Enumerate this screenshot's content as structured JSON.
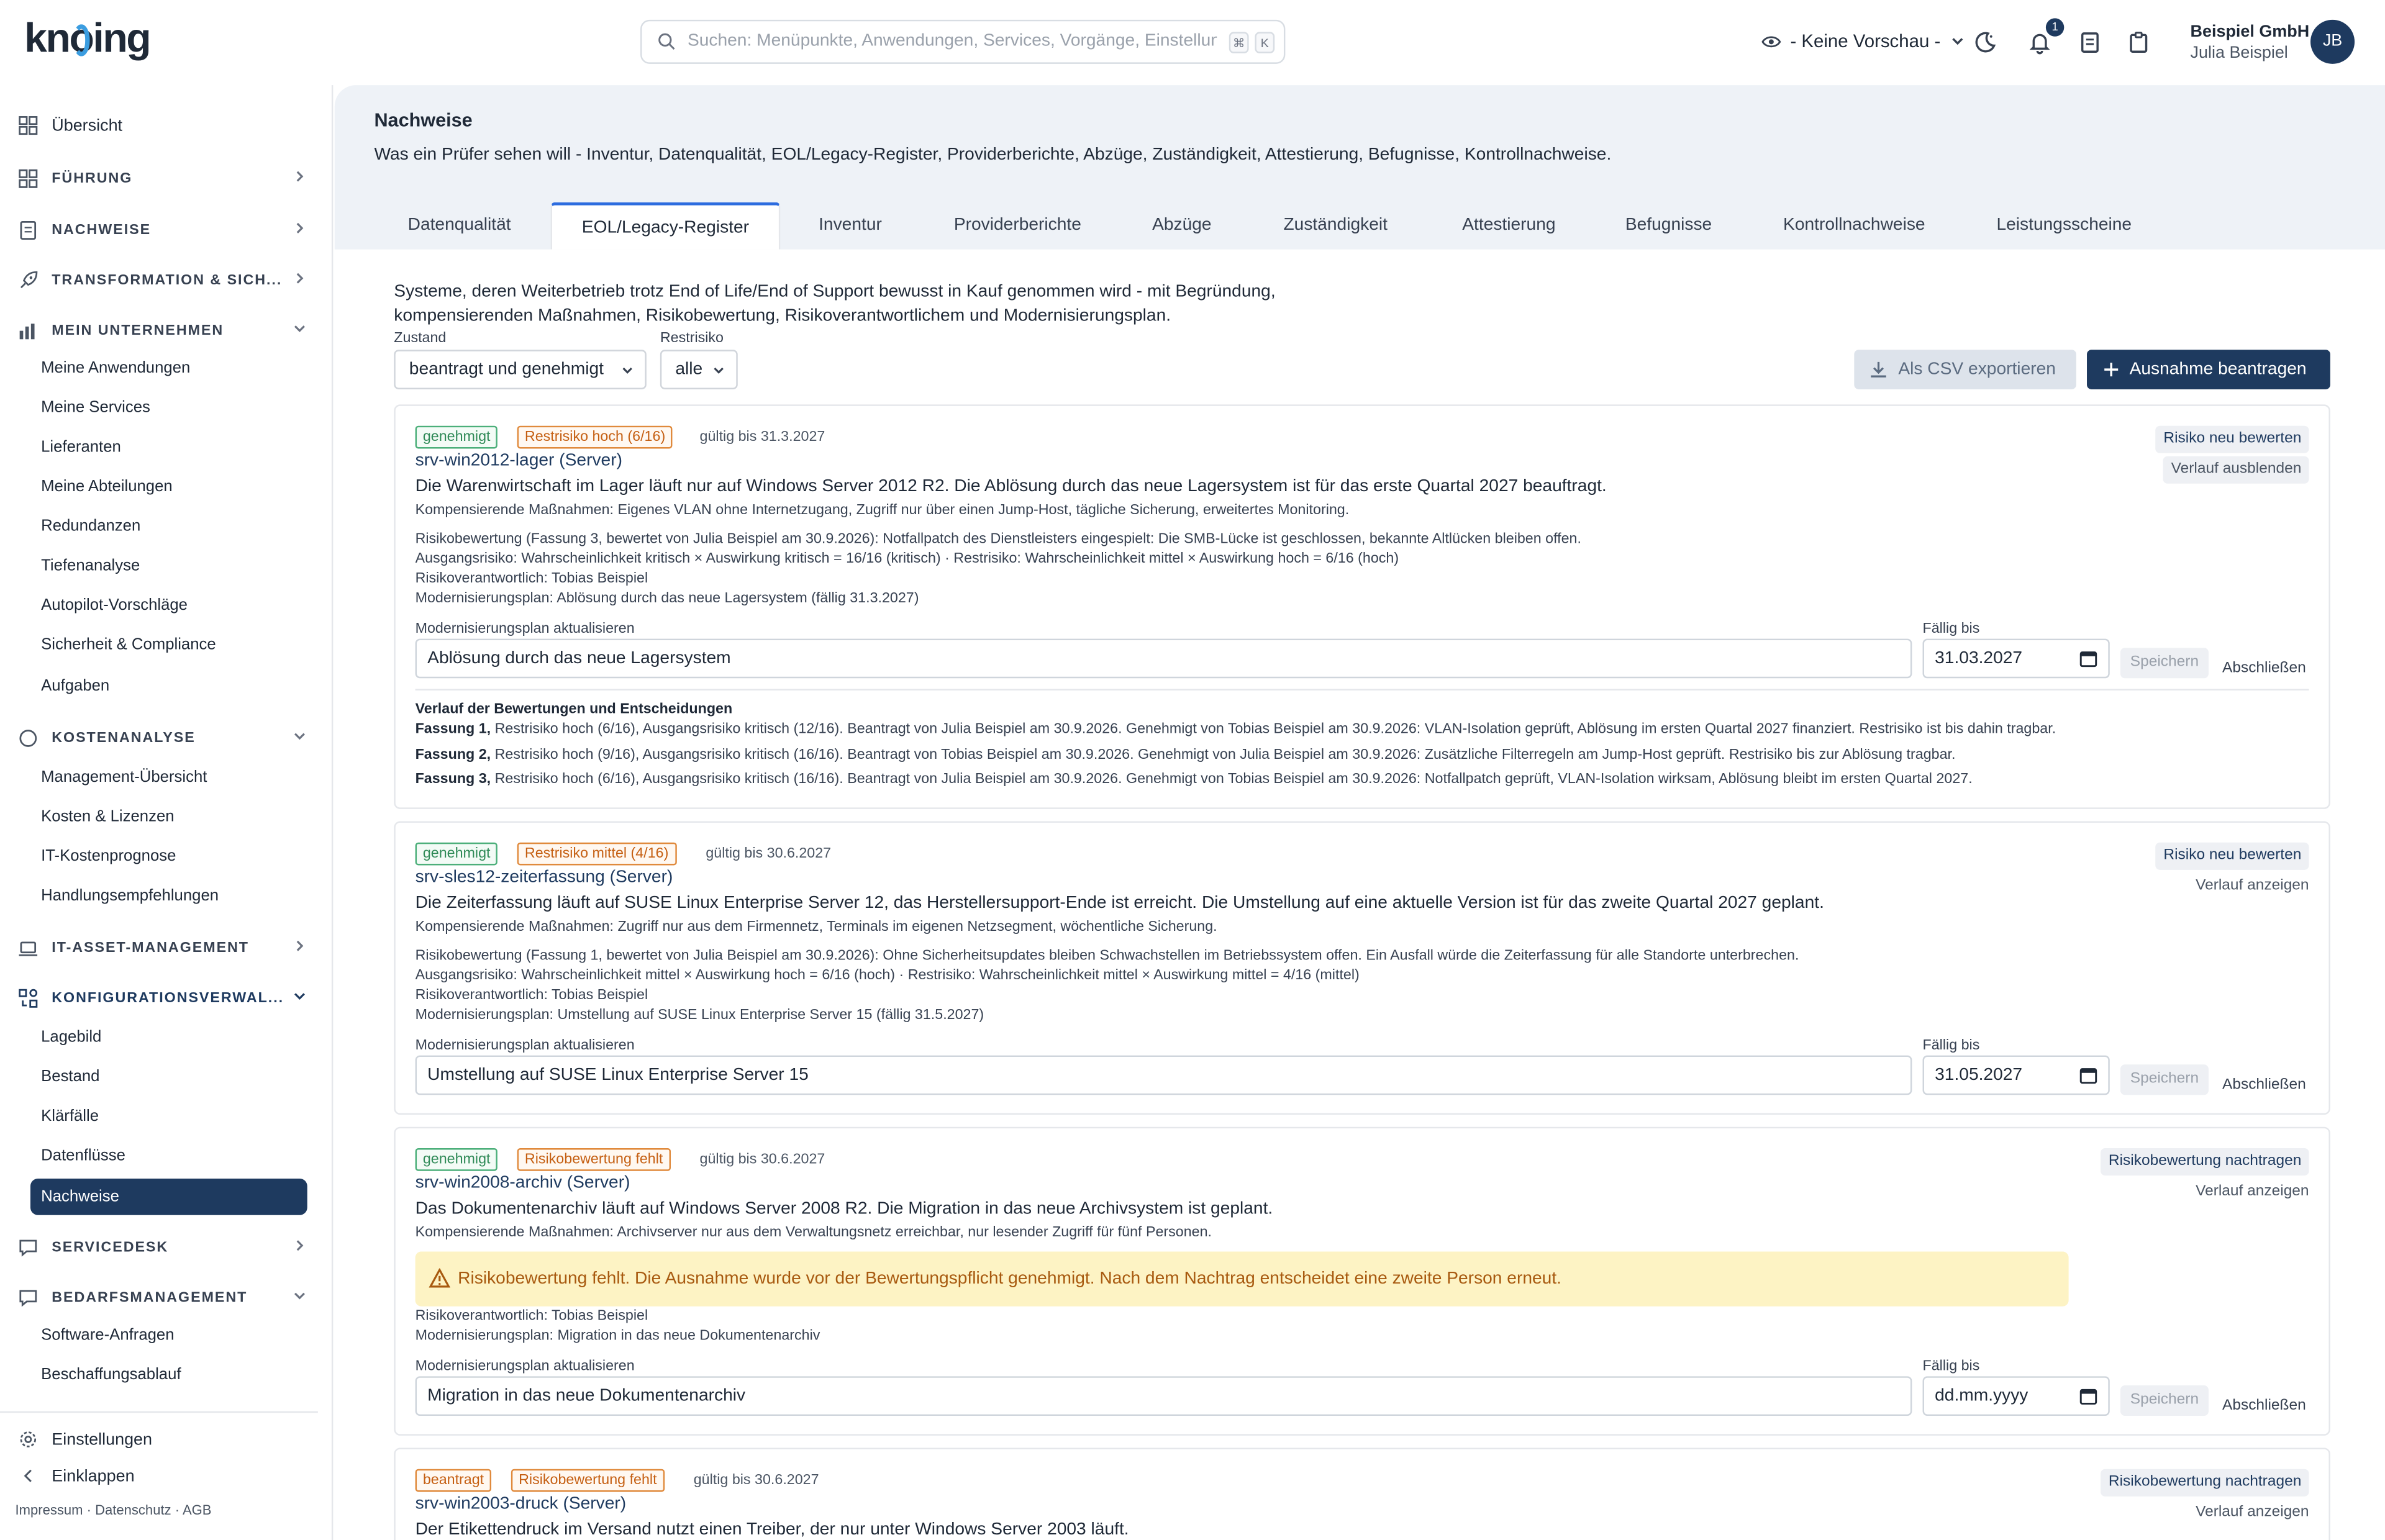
{
  "app": {
    "logo": "knoing",
    "search_placeholder": "Suchen: Menüpunkte, Anwendungen, Services, Vorgänge, Einstellungen",
    "kbd1": "⌘",
    "kbd2": "K",
    "preview": "- Keine Vorschau -",
    "notifications": "1",
    "company": "Beispiel GmbH",
    "user": "Julia Beispiel",
    "initials": "JB"
  },
  "sidebar": {
    "overview": "Übersicht",
    "fuehrung": "FÜHRUNG",
    "nachweise": "NACHWEISE",
    "transformation": "TRANSFORMATION & SICH...",
    "mein_unternehmen": "MEIN UNTERNEHMEN",
    "mu_items": [
      "Meine Anwendungen",
      "Meine Services",
      "Lieferanten",
      "Meine Abteilungen",
      "Redundanzen",
      "Tiefenanalyse",
      "Autopilot-Vorschläge",
      "Sicherheit & Compliance",
      "Aufgaben"
    ],
    "kostenanalyse": "KOSTENANALYSE",
    "ka_items": [
      "Management-Übersicht",
      "Kosten & Lizenzen",
      "IT-Kostenprognose",
      "Handlungsempfehlungen"
    ],
    "itam": "IT-ASSET-MANAGEMENT",
    "konfig": "KONFIGURATIONSVERWAL...",
    "kv_items": [
      "Lagebild",
      "Bestand",
      "Klärfälle",
      "Datenflüsse"
    ],
    "kv_active": "Nachweise",
    "servicedesk": "SERVICEDESK",
    "bedarf": "BEDARFSMANAGEMENT",
    "bm_items": [
      "Software-Anfragen",
      "Beschaffungsablauf"
    ],
    "settings": "Einstellungen",
    "collapse": "Einklappen",
    "footer": "Impressum  ·  Datenschutz  ·  AGB"
  },
  "page": {
    "title": "Nachweise",
    "subtitle": "Was ein Prüfer sehen will - Inventur, Datenqualität, EOL/Legacy-Register, Providerberichte, Abzüge, Zuständigkeit, Attestierung, Befugnisse, Kontrollnachweise.",
    "tabs": [
      "Datenqualität",
      "EOL/Legacy-Register",
      "Inventur",
      "Providerberichte",
      "Abzüge",
      "Zuständigkeit",
      "Attestierung",
      "Befugnisse",
      "Kontrollnachweise",
      "Leistungsscheine"
    ],
    "intro_1": "Systeme, deren Weiterbetrieb trotz End of Life/End of Support bewusst in Kauf genommen wird - mit Begründung,",
    "intro_2": "kompensierenden Maßnahmen, Risikobewertung, Risikoverantwortlichem und Modernisierungsplan.",
    "zustand_label": "Zustand",
    "zustand_value": "beantragt und genehmigt",
    "restrisiko_label": "Restrisiko",
    "restrisiko_value": "alle",
    "export": "Als CSV exportieren",
    "request": "Ausnahme beantragen"
  },
  "common": {
    "plan_label": "Modernisierungsplan aktualisieren",
    "due_label": "Fällig bis",
    "save": "Speichern",
    "close": "Abschließen",
    "risk_reassess": "Risiko neu bewerten",
    "risk_add": "Risikobewertung nachtragen",
    "hide_history": "Verlauf ausblenden",
    "show_history": "Verlauf anzeigen"
  },
  "cards": [
    {
      "status": "genehmigt",
      "risk": "Restrisiko hoch (6/16)",
      "valid": "gültig bis 31.3.2027",
      "name": "srv-win2012-lager (Server)",
      "desc": "Die Warenwirtschaft im Lager läuft nur auf Windows Server 2012 R2. Die Ablösung durch das neue Lagersystem ist für das erste Quartal 2027 beauftragt.",
      "comp": "Kompensierende Maßnahmen: Eigenes VLAN ohne Internetzugang, Zugriff nur über einen Jump-Host, tägliche Sicherung, erweitertes Monitoring.",
      "assessment": "Risikobewertung (Fassung 3, bewertet von Julia Beispiel am 30.9.2026): Notfallpatch des Dienstleisters eingespielt: Die SMB-Lücke ist geschlossen, bekannte Altlücken bleiben offen.",
      "baseline": "Ausgangsrisiko: Wahrscheinlichkeit kritisch × Auswirkung kritisch = 16/16 (kritisch) · Restrisiko: Wahrscheinlichkeit mittel × Auswirkung hoch = 6/16 (hoch)",
      "owner": "Risikoverantwortlich: Tobias Beispiel",
      "plan": "Modernisierungsplan: Ablösung durch das neue Lagersystem (fällig 31.3.2027)",
      "plan_value": "Ablösung durch das neue Lagersystem",
      "due_value": "31.03.2027",
      "history_title": "Verlauf der Bewertungen und Entscheidungen",
      "history": [
        {
          "v": "Fassung 1,",
          "t": " Restrisiko hoch (6/16), Ausgangsrisiko kritisch (12/16). Beantragt von Julia Beispiel am 30.9.2026. Genehmigt von Tobias Beispiel am 30.9.2026: VLAN-Isolation geprüft, Ablösung im ersten Quartal 2027 finanziert. Restrisiko ist bis dahin tragbar."
        },
        {
          "v": "Fassung 2,",
          "t": " Restrisiko hoch (9/16), Ausgangsrisiko kritisch (16/16). Beantragt von Tobias Beispiel am 30.9.2026. Genehmigt von Julia Beispiel am 30.9.2026: Zusätzliche Filterregeln am Jump-Host geprüft. Restrisiko bis zur Ablösung tragbar."
        },
        {
          "v": "Fassung 3,",
          "t": " Restrisiko hoch (6/16), Ausgangsrisiko kritisch (16/16). Beantragt von Julia Beispiel am 30.9.2026. Genehmigt von Tobias Beispiel am 30.9.2026: Notfallpatch geprüft, VLAN-Isolation wirksam, Ablösung bleibt im ersten Quartal 2027."
        }
      ]
    },
    {
      "status": "genehmigt",
      "risk": "Restrisiko mittel (4/16)",
      "valid": "gültig bis 30.6.2027",
      "name": "srv-sles12-zeiterfassung (Server)",
      "desc": "Die Zeiterfassung läuft auf SUSE Linux Enterprise Server 12, das Herstellersupport-Ende ist erreicht. Die Umstellung auf eine aktuelle Version ist für das zweite Quartal 2027 geplant.",
      "comp": "Kompensierende Maßnahmen: Zugriff nur aus dem Firmennetz, Terminals im eigenen Netzsegment, wöchentliche Sicherung.",
      "assessment": "Risikobewertung (Fassung 1, bewertet von Julia Beispiel am 30.9.2026): Ohne Sicherheitsupdates bleiben Schwachstellen im Betriebssystem offen. Ein Ausfall würde die Zeiterfassung für alle Standorte unterbrechen.",
      "baseline": "Ausgangsrisiko: Wahrscheinlichkeit mittel × Auswirkung hoch = 6/16 (hoch) · Restrisiko: Wahrscheinlichkeit mittel × Auswirkung mittel = 4/16 (mittel)",
      "owner": "Risikoverantwortlich: Tobias Beispiel",
      "plan": "Modernisierungsplan: Umstellung auf SUSE Linux Enterprise Server 15 (fällig 31.5.2027)",
      "plan_value": "Umstellung auf SUSE Linux Enterprise Server 15",
      "due_value": "31.05.2027"
    },
    {
      "status": "genehmigt",
      "risk": "Risikobewertung fehlt",
      "valid": "gültig bis 30.6.2027",
      "name": "srv-win2008-archiv (Server)",
      "desc": "Das Dokumentenarchiv läuft auf Windows Server 2008 R2. Die Migration in das neue Archivsystem ist geplant.",
      "comp": "Kompensierende Maßnahmen: Archivserver nur aus dem Verwaltungsnetz erreichbar, nur lesender Zugriff für fünf Personen.",
      "warning": "Risikobewertung fehlt. Die Ausnahme wurde vor der Bewertungspflicht genehmigt. Nach dem Nachtrag entscheidet eine zweite Person erneut.",
      "owner": "Risikoverantwortlich: Tobias Beispiel",
      "plan": "Modernisierungsplan: Migration in das neue Dokumentenarchiv",
      "plan_value": "Migration in das neue Dokumentenarchiv",
      "due_value": "dd.mm.yyyy"
    },
    {
      "status": "beantragt",
      "risk": "Risikobewertung fehlt",
      "valid": "gültig bis 30.6.2027",
      "name": "srv-win2003-druck (Server)",
      "desc": "Der Etikettendruck im Versand nutzt einen Treiber, der nur unter Windows Server 2003 läuft."
    }
  ]
}
